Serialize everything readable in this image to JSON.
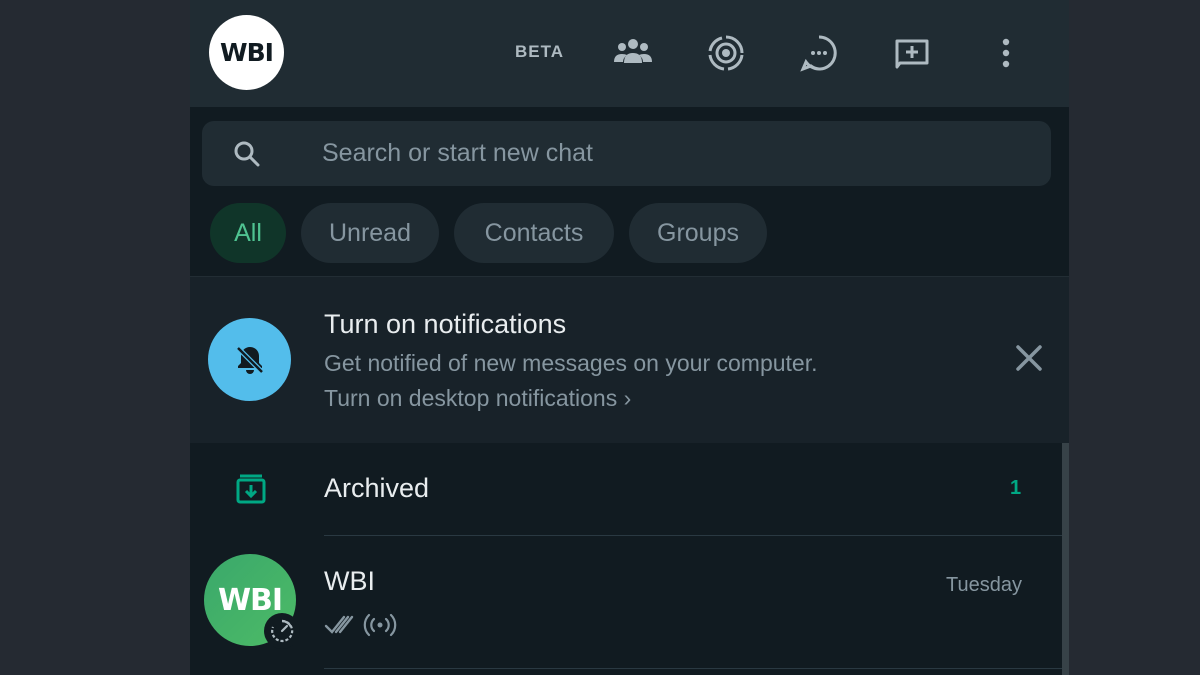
{
  "header": {
    "avatar_text": "WBI",
    "beta_label": "BETA",
    "icons": [
      "communities-icon",
      "status-icon",
      "channels-icon",
      "new-chat-icon",
      "menu-icon"
    ]
  },
  "search": {
    "placeholder": "Search or start new chat",
    "value": ""
  },
  "filters": [
    {
      "label": "All",
      "active": true
    },
    {
      "label": "Unread",
      "active": false
    },
    {
      "label": "Contacts",
      "active": false
    },
    {
      "label": "Groups",
      "active": false
    }
  ],
  "notification": {
    "title": "Turn on notifications",
    "subtitle": "Get notified of new messages on your computer.",
    "link": "Turn on desktop notifications ›"
  },
  "archived": {
    "label": "Archived",
    "count": "1"
  },
  "chats": [
    {
      "name": "WBI",
      "avatar_text": "WBI",
      "time": "Tuesday"
    }
  ],
  "colors": {
    "accent": "#00a884",
    "active_chip_bg": "#103529",
    "active_chip_text": "#4fc391",
    "bell_bg": "#53bdeb",
    "panel_bg": "#111b21",
    "header_bg": "#202c33"
  }
}
